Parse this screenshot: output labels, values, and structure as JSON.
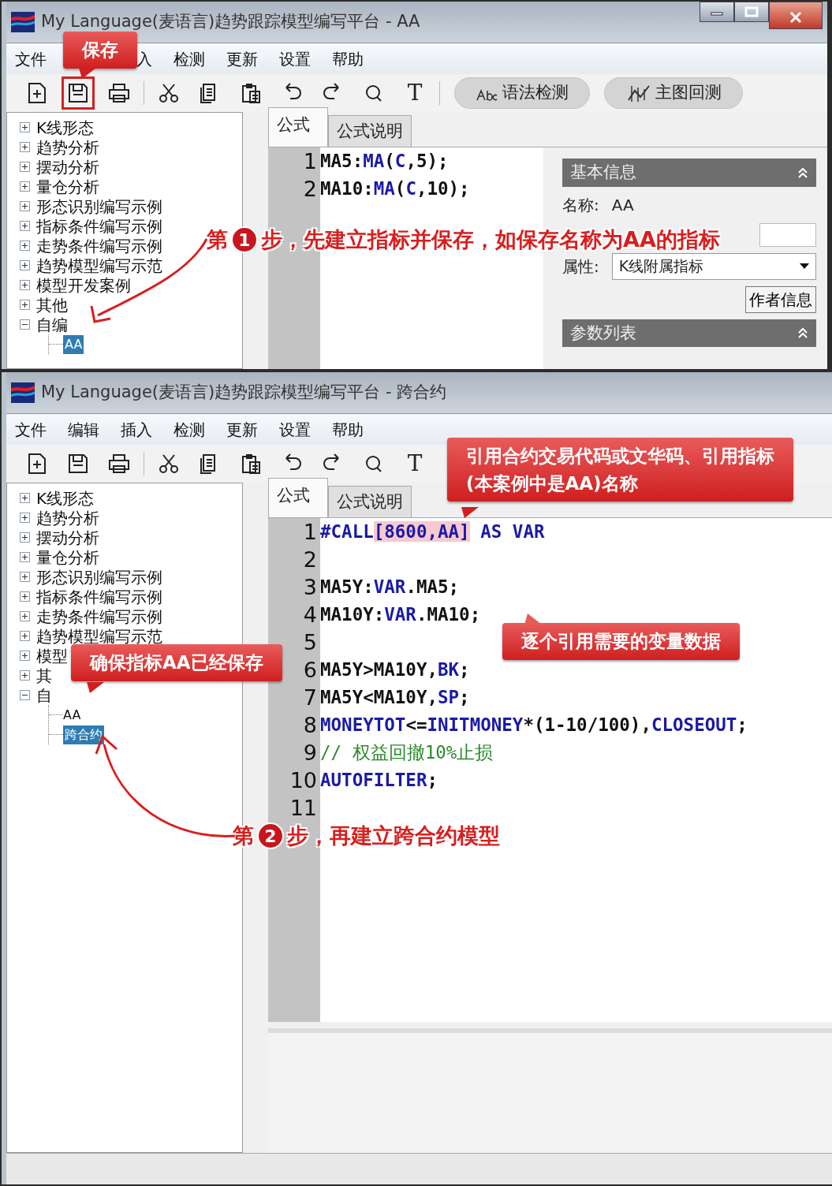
{
  "windows": [
    {
      "title": "My Language(麦语言)趋势跟踪模型编写平台 - AA",
      "window_buttons": true,
      "menu": [
        "文件",
        "入",
        "检测",
        "更新",
        "设置",
        "帮助"
      ],
      "toolbar": [
        {
          "kind": "new"
        },
        {
          "kind": "save",
          "highlighted": true
        },
        {
          "kind": "print"
        },
        {
          "kind": "sep"
        },
        {
          "kind": "cut"
        },
        {
          "kind": "copy"
        },
        {
          "kind": "paste"
        },
        {
          "kind": "undo"
        },
        {
          "kind": "redo"
        },
        {
          "kind": "search"
        },
        {
          "kind": "text",
          "label": "T"
        },
        {
          "kind": "sep"
        }
      ],
      "toolbar_buttons": [
        {
          "kind": "spell",
          "label": "语法检测"
        },
        {
          "kind": "chart",
          "label": "主图回测"
        }
      ],
      "tree": [
        {
          "label": "K线形态",
          "expanded": false
        },
        {
          "label": "趋势分析",
          "expanded": false
        },
        {
          "label": "摆动分析",
          "expanded": false
        },
        {
          "label": "量仓分析",
          "expanded": false
        },
        {
          "label": "形态识别编写示例",
          "expanded": false
        },
        {
          "label": "指标条件编写示例",
          "expanded": false
        },
        {
          "label": "走势条件编写示例",
          "expanded": false
        },
        {
          "label": "趋势模型编写示范",
          "expanded": false
        },
        {
          "label": "模型开发案例",
          "expanded": false
        },
        {
          "label": "其他",
          "expanded": false
        },
        {
          "label": "自编",
          "expanded": true,
          "children": [
            {
              "label": "AA",
              "selected": true
            }
          ]
        }
      ],
      "tabs": [
        {
          "label": "公式",
          "selected": true
        },
        {
          "label": "公式说明",
          "selected": false
        }
      ],
      "code": [
        {
          "number": "1",
          "tokens": [
            {
              "kind": "plain",
              "text": "MA5:"
            },
            {
              "kind": "kw",
              "text": "MA"
            },
            {
              "kind": "plain",
              "text": "("
            },
            {
              "kind": "kw",
              "text": "C"
            },
            {
              "kind": "plain",
              "text": ",5);"
            }
          ]
        },
        {
          "number": "2",
          "tokens": [
            {
              "kind": "plain",
              "text": "MA10:"
            },
            {
              "kind": "kw",
              "text": "MA"
            },
            {
              "kind": "plain",
              "text": "("
            },
            {
              "kind": "kw",
              "text": "C"
            },
            {
              "kind": "plain",
              "text": ",10);"
            }
          ]
        }
      ],
      "info_panel": {
        "basic_header": "基本信息",
        "name_label": "名称:",
        "name_value": "AA",
        "attr_label": "属性:",
        "attr_value": "K线附属指标",
        "author_button": "作者信息",
        "params_header": "参数列表"
      }
    },
    {
      "title": "My Language(麦语言)趋势跟踪模型编写平台 - 跨合约",
      "menu": [
        "文件",
        "编辑",
        "插入",
        "检测",
        "更新",
        "设置",
        "帮助"
      ],
      "toolbar": [
        {
          "kind": "new"
        },
        {
          "kind": "save"
        },
        {
          "kind": "print"
        },
        {
          "kind": "sep"
        },
        {
          "kind": "cut"
        },
        {
          "kind": "copy"
        },
        {
          "kind": "paste"
        },
        {
          "kind": "undo"
        },
        {
          "kind": "redo"
        },
        {
          "kind": "search"
        },
        {
          "kind": "text",
          "label": "T"
        }
      ],
      "tree": [
        {
          "label": "K线形态",
          "expanded": false
        },
        {
          "label": "趋势分析",
          "expanded": false
        },
        {
          "label": "摆动分析",
          "expanded": false
        },
        {
          "label": "量仓分析",
          "expanded": false
        },
        {
          "label": "形态识别编写示例",
          "expanded": false
        },
        {
          "label": "指标条件编写示例",
          "expanded": false
        },
        {
          "label": "走势条件编写示例",
          "expanded": false
        },
        {
          "label": "趋势模型编写示范",
          "expanded": false
        },
        {
          "label": "模型",
          "expanded": false
        },
        {
          "label": "其",
          "expanded": false
        },
        {
          "label": "自",
          "expanded": true,
          "children": [
            {
              "label": "AA",
              "selected": false
            },
            {
              "label": "跨合约",
              "selected": true
            }
          ]
        }
      ],
      "tabs": [
        {
          "label": "公式",
          "selected": true
        },
        {
          "label": "公式说明",
          "selected": false
        }
      ],
      "code": [
        {
          "number": "1",
          "tokens": [
            {
              "kind": "kw",
              "text": "#CALL"
            },
            {
              "kind": "hl",
              "text": "[8600,AA]"
            },
            {
              "kind": "kw",
              "text": " AS VAR"
            }
          ]
        },
        {
          "number": "2"
        },
        {
          "number": "3",
          "tokens": [
            {
              "kind": "plain",
              "text": "MA5Y:"
            },
            {
              "kind": "kw",
              "text": "VAR"
            },
            {
              "kind": "plain",
              "text": ".MA5;"
            }
          ]
        },
        {
          "number": "4",
          "tokens": [
            {
              "kind": "plain",
              "text": "MA10Y:"
            },
            {
              "kind": "kw",
              "text": "VAR"
            },
            {
              "kind": "plain",
              "text": ".MA10;"
            }
          ]
        },
        {
          "number": "5"
        },
        {
          "number": "6",
          "tokens": [
            {
              "kind": "plain",
              "text": "MA5Y>MA10Y,"
            },
            {
              "kind": "kw",
              "text": "BK"
            },
            {
              "kind": "plain",
              "text": ";"
            }
          ]
        },
        {
          "number": "7",
          "tokens": [
            {
              "kind": "plain",
              "text": "MA5Y<MA10Y,"
            },
            {
              "kind": "kw",
              "text": "SP"
            },
            {
              "kind": "plain",
              "text": ";"
            }
          ]
        },
        {
          "number": "8",
          "tokens": [
            {
              "kind": "kw",
              "text": "MONEYTOT"
            },
            {
              "kind": "plain",
              "text": "<="
            },
            {
              "kind": "kw",
              "text": "INITMONEY"
            },
            {
              "kind": "plain",
              "text": "*(1-10/100),"
            },
            {
              "kind": "kw",
              "text": "CLOSEOUT"
            },
            {
              "kind": "plain",
              "text": ";"
            }
          ]
        },
        {
          "number": "9",
          "tokens": [
            {
              "kind": "cm",
              "text": "// 权益回撤10%止损"
            }
          ]
        },
        {
          "number": "10",
          "tokens": [
            {
              "kind": "kw",
              "text": "AUTOFILTER"
            },
            {
              "kind": "plain",
              "text": ";"
            }
          ]
        },
        {
          "number": "11"
        }
      ],
      "status_bar": true
    }
  ],
  "annotations": [
    {
      "kind": "callout",
      "lines": [
        "保存"
      ]
    },
    {
      "kind": "step",
      "prefix": "第",
      "number": "1",
      "text": "步，先建立指标并保存，如保存名称为AA的指标"
    },
    {
      "kind": "callout",
      "lines": [
        "引用合约交易代码或文华码、引用指标",
        "(本案例中是AA)名称"
      ]
    },
    {
      "kind": "callout",
      "lines": [
        "逐个引用需要的变量数据"
      ]
    },
    {
      "kind": "callout",
      "lines": [
        "确保指标AA已经保存"
      ]
    },
    {
      "kind": "step",
      "prefix": "第",
      "number": "2",
      "text": "步，再建立跨合约模型"
    }
  ]
}
